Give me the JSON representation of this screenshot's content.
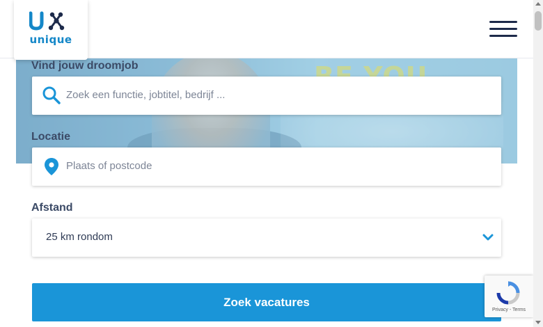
{
  "header": {
    "logo_text": "unique",
    "menu_icon": "hamburger-menu-icon"
  },
  "hero": {
    "slogan": "BE YOU"
  },
  "search_form": {
    "job": {
      "label": "Vind jouw droomjob",
      "placeholder": "Zoek een functie, jobtitel, bedrijf ...",
      "icon": "search-icon"
    },
    "location": {
      "label": "Locatie",
      "placeholder": "Plaats of postcode",
      "icon": "location-pin-icon"
    },
    "distance": {
      "label": "Afstand",
      "selected": "25 km rondom",
      "icon": "chevron-down-icon"
    },
    "submit_label": "Zoek vacatures"
  },
  "recaptcha": {
    "links": "Privacy - Terms"
  },
  "colors": {
    "brand_blue": "#1a95d8",
    "dark_navy": "#1d2a4a",
    "label_text": "#3b4a66"
  }
}
